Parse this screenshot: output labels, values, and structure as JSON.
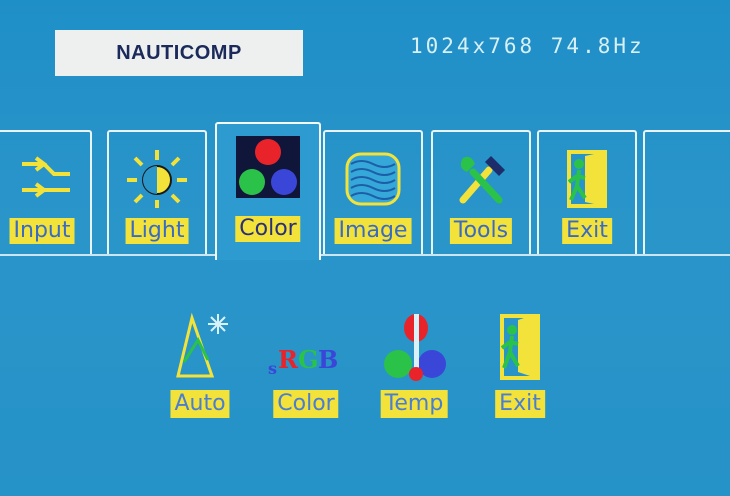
{
  "brand": {
    "logo_text": "NAUTICOMP"
  },
  "status": {
    "resolution": "1024x768 74.8Hz"
  },
  "tabs": [
    {
      "label": "Input",
      "icon": "input-arrows-icon"
    },
    {
      "label": "Light",
      "icon": "sun-icon"
    },
    {
      "label": "Color",
      "icon": "color-dots-icon",
      "active": true
    },
    {
      "label": "Image",
      "icon": "image-waves-icon"
    },
    {
      "label": "Tools",
      "icon": "tools-icon"
    },
    {
      "label": "Exit",
      "icon": "exit-door-icon"
    }
  ],
  "submenu": [
    {
      "label": "Auto",
      "icon": "auto-sparkle-icon"
    },
    {
      "label": "Color",
      "icon": "srgb-icon",
      "icon_text": {
        "prefix": "s",
        "r": "R",
        "g": "G",
        "b": "B"
      }
    },
    {
      "label": "Temp",
      "icon": "thermometer-icon"
    },
    {
      "label": "Exit",
      "icon": "exit-door-icon"
    }
  ],
  "colors": {
    "label_bg": "#f2e23a",
    "label_fg": "#3a6bc4",
    "background": "#2592c8"
  }
}
